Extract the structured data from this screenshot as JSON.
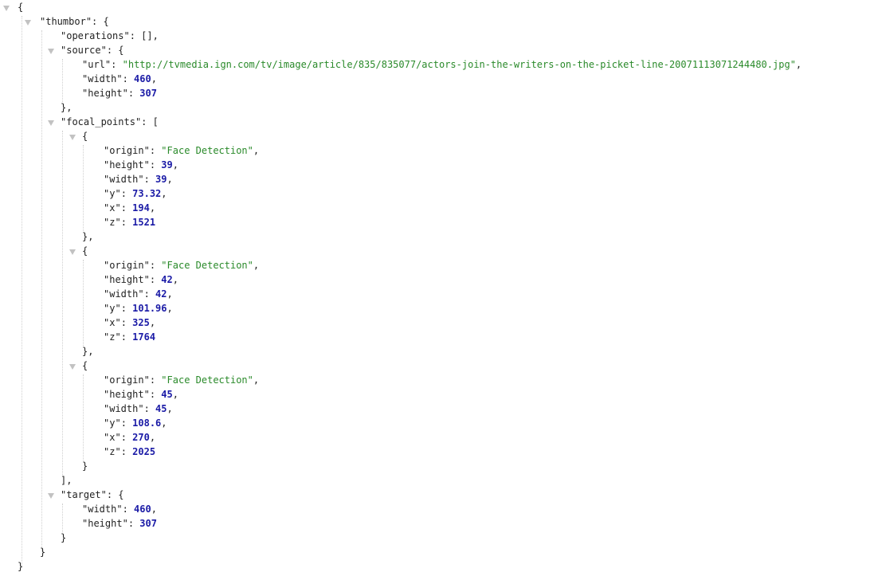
{
  "thumbor": {
    "key": "thumbor",
    "operations": {
      "key": "operations",
      "value": "[]"
    },
    "source": {
      "key": "source",
      "url": {
        "key": "url",
        "value": "http://tvmedia.ign.com/tv/image/article/835/835077/actors-join-the-writers-on-the-picket-line-20071113071244480.jpg"
      },
      "width": {
        "key": "width",
        "value": "460"
      },
      "height": {
        "key": "height",
        "value": "307"
      }
    },
    "focal_points": {
      "key": "focal_points",
      "items": [
        {
          "origin": {
            "key": "origin",
            "value": "Face Detection"
          },
          "height": {
            "key": "height",
            "value": "39"
          },
          "width": {
            "key": "width",
            "value": "39"
          },
          "y": {
            "key": "y",
            "value": "73.32"
          },
          "x": {
            "key": "x",
            "value": "194"
          },
          "z": {
            "key": "z",
            "value": "1521"
          }
        },
        {
          "origin": {
            "key": "origin",
            "value": "Face Detection"
          },
          "height": {
            "key": "height",
            "value": "42"
          },
          "width": {
            "key": "width",
            "value": "42"
          },
          "y": {
            "key": "y",
            "value": "101.96"
          },
          "x": {
            "key": "x",
            "value": "325"
          },
          "z": {
            "key": "z",
            "value": "1764"
          }
        },
        {
          "origin": {
            "key": "origin",
            "value": "Face Detection"
          },
          "height": {
            "key": "height",
            "value": "45"
          },
          "width": {
            "key": "width",
            "value": "45"
          },
          "y": {
            "key": "y",
            "value": "108.6"
          },
          "x": {
            "key": "x",
            "value": "270"
          },
          "z": {
            "key": "z",
            "value": "2025"
          }
        }
      ]
    },
    "target": {
      "key": "target",
      "width": {
        "key": "width",
        "value": "460"
      },
      "height": {
        "key": "height",
        "value": "307"
      }
    }
  }
}
